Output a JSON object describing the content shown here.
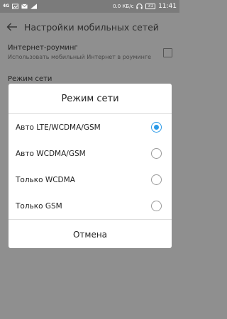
{
  "status_bar": {
    "network_label": "4G",
    "speed": "0.0 КБ/с",
    "battery": "31",
    "time": "11:41"
  },
  "app_bar": {
    "title": "Настройки мобильных сетей"
  },
  "settings": {
    "roaming_title": "Интернет-роуминг",
    "roaming_subtitle": "Использовать мобильный Интернет в роуминге",
    "network_mode_title": "Режим сети"
  },
  "dialog": {
    "title": "Режим сети",
    "options": [
      {
        "label": "Авто LTE/WCDMA/GSM",
        "selected": true
      },
      {
        "label": "Авто WCDMA/GSM",
        "selected": false
      },
      {
        "label": "Только WCDMA",
        "selected": false
      },
      {
        "label": "Только GSM",
        "selected": false
      }
    ],
    "cancel_label": "Отмена"
  },
  "colors": {
    "accent": "#2a9ae8",
    "scrim": "#8f8f8f"
  }
}
